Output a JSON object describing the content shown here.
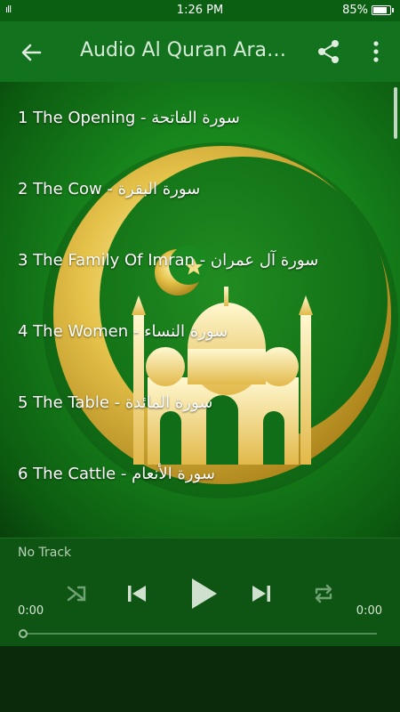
{
  "status_bar": {
    "time": "1:26 PM",
    "battery": "85%",
    "signal": "ıll",
    "battery_level": 0.85
  },
  "app_bar": {
    "title": "Audio Al Quran Arabic English"
  },
  "tracks": [
    {
      "label": "1 The Opening - سورة الفاتحة"
    },
    {
      "label": "2 The Cow - سورة البقرة"
    },
    {
      "label": "3 The Family Of Imran - سورة آل عمران"
    },
    {
      "label": "4 The Women - سورة النساء"
    },
    {
      "label": "5 The Table - سورة المائدة"
    },
    {
      "label": "6 The Cattle - سورة الأنعام"
    }
  ],
  "player": {
    "now_playing": "No Track",
    "elapsed": "0:00",
    "duration": "0:00",
    "progress": 0
  },
  "colors": {
    "accent": "#12721e",
    "status": "#0a5f12",
    "player": "#0e5513",
    "crescent": "#e5c24a"
  },
  "icons": [
    "back-arrow-icon",
    "share-icon",
    "more-vert-icon",
    "shuffle-icon",
    "skip-previous-icon",
    "play-icon",
    "skip-next-icon",
    "repeat-icon"
  ]
}
